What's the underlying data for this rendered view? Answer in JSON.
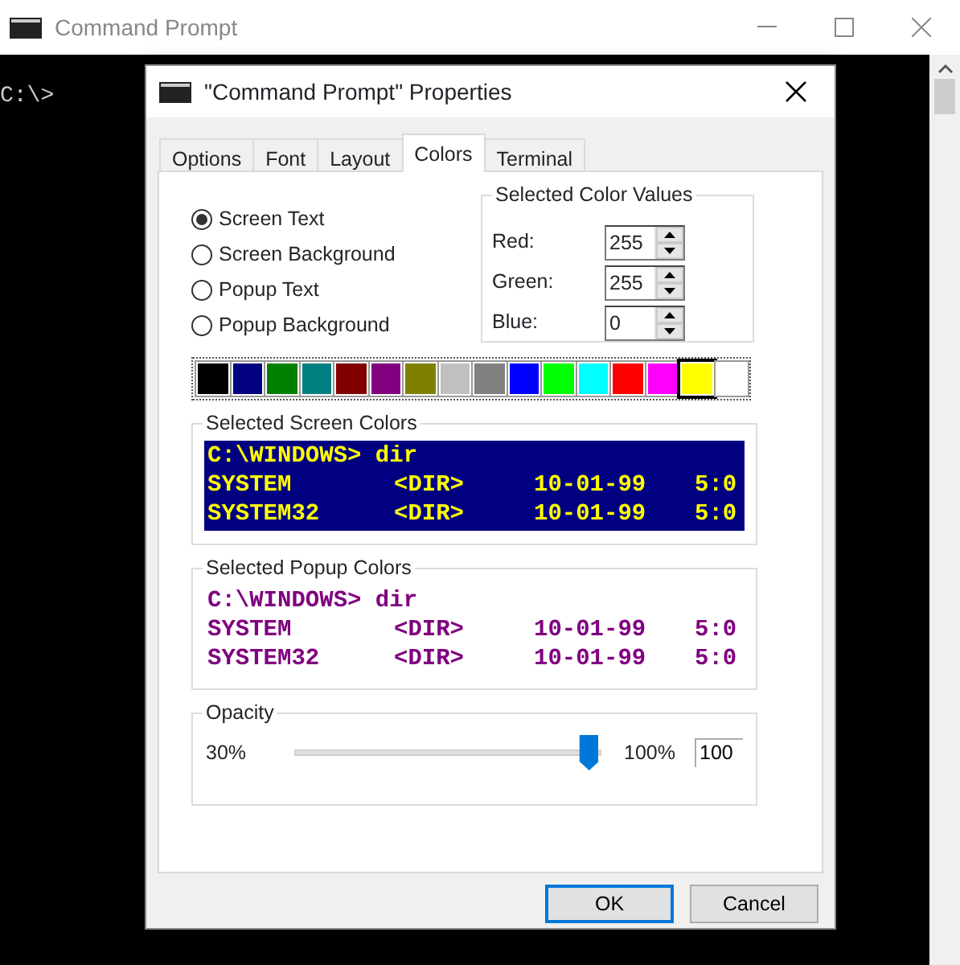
{
  "window": {
    "title": "Command Prompt"
  },
  "console": {
    "text": "C:\\>"
  },
  "dialog": {
    "title": "\"Command Prompt\" Properties",
    "tabs": [
      {
        "label": "Options",
        "selected": false
      },
      {
        "label": "Font",
        "selected": false
      },
      {
        "label": "Layout",
        "selected": false
      },
      {
        "label": "Colors",
        "selected": true
      },
      {
        "label": "Terminal",
        "selected": false
      }
    ],
    "targets": [
      {
        "label": "Screen Text",
        "selected": true
      },
      {
        "label": "Screen Background",
        "selected": false
      },
      {
        "label": "Popup Text",
        "selected": false
      },
      {
        "label": "Popup Background",
        "selected": false
      }
    ],
    "color_values": {
      "title": "Selected Color Values",
      "fields": [
        {
          "label": "Red:",
          "value": "255"
        },
        {
          "label": "Green:",
          "value": "255"
        },
        {
          "label": "Blue:",
          "value": "0"
        }
      ]
    },
    "palette": [
      {
        "color": "#000000",
        "selected": false
      },
      {
        "color": "#000080",
        "selected": false
      },
      {
        "color": "#008000",
        "selected": false
      },
      {
        "color": "#008080",
        "selected": false
      },
      {
        "color": "#800000",
        "selected": false
      },
      {
        "color": "#800080",
        "selected": false
      },
      {
        "color": "#808000",
        "selected": false
      },
      {
        "color": "#c0c0c0",
        "selected": false
      },
      {
        "color": "#808080",
        "selected": false
      },
      {
        "color": "#0000ff",
        "selected": false
      },
      {
        "color": "#00ff00",
        "selected": false
      },
      {
        "color": "#00ffff",
        "selected": false
      },
      {
        "color": "#ff0000",
        "selected": false
      },
      {
        "color": "#ff00ff",
        "selected": false
      },
      {
        "color": "#ffff00",
        "selected": true
      },
      {
        "color": "#ffffff",
        "selected": false
      }
    ],
    "previews": [
      {
        "title": "Selected Screen Colors",
        "color": "#ffff00",
        "background": {
          "color": "#000080"
        },
        "command": "C:\\WINDOWS> dir",
        "rows": [
          [
            "SYSTEM",
            "<DIR>",
            "10-01-99",
            "5:0"
          ],
          [
            "SYSTEM32",
            "<DIR>",
            "10-01-99",
            "5:0"
          ]
        ]
      },
      {
        "title": "Selected Popup Colors",
        "color": "#800080",
        "background": {
          "color": "#ffffff"
        },
        "command": "C:\\WINDOWS> dir",
        "rows": [
          [
            "SYSTEM",
            "<DIR>",
            "10-01-99",
            "5:0"
          ],
          [
            "SYSTEM32",
            "<DIR>",
            "10-01-99",
            "5:0"
          ]
        ]
      }
    ],
    "opacity": {
      "title": "Opacity",
      "min_label": "30%",
      "max_label": "100%",
      "level": 1,
      "value": "100"
    },
    "buttons": [
      {
        "label": "OK",
        "default": true
      },
      {
        "label": "Cancel",
        "default": false
      }
    ]
  }
}
